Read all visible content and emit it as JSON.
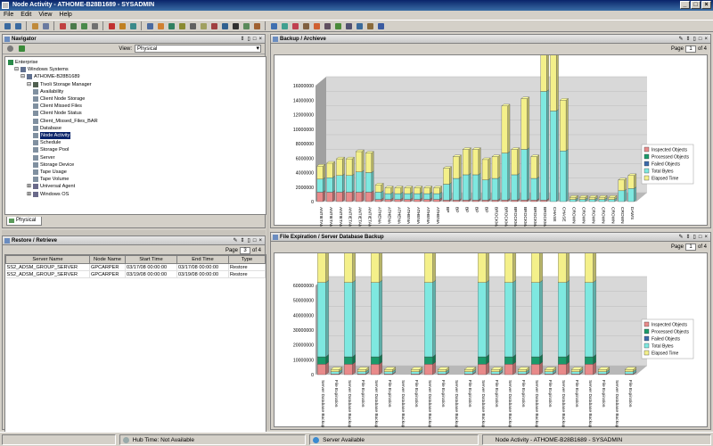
{
  "window": {
    "title": "Node Activity - ATHOME-B28B1689 - SYSADMIN"
  },
  "menu": [
    "File",
    "Edit",
    "View",
    "Help"
  ],
  "navigator": {
    "title": "Navigator",
    "view_label": "View:",
    "view_value": "Physical",
    "tab_label": "Physical",
    "tree": [
      {
        "label": "Enterprise",
        "level": 0,
        "icon": "globe-icon"
      },
      {
        "label": "Windows Systems",
        "level": 1,
        "icon": "computer-icon"
      },
      {
        "label": "ATHOME-B28B1689",
        "level": 2,
        "icon": "computer-icon"
      },
      {
        "label": "Tivoli Storage Manager",
        "level": 3,
        "icon": "storage-icon"
      },
      {
        "label": "Availability",
        "level": 4,
        "icon": "workspace-icon"
      },
      {
        "label": "Client Node Storage",
        "level": 4,
        "icon": "workspace-icon"
      },
      {
        "label": "Client Missed Files",
        "level": 4,
        "icon": "workspace-icon"
      },
      {
        "label": "Client Node Status",
        "level": 4,
        "icon": "workspace-icon"
      },
      {
        "label": "Client_Missed_Files_BAR",
        "level": 4,
        "icon": "workspace-icon"
      },
      {
        "label": "Database",
        "level": 4,
        "icon": "workspace-icon"
      },
      {
        "label": "Node Activity",
        "level": 4,
        "icon": "workspace-icon",
        "selected": true
      },
      {
        "label": "Schedule",
        "level": 4,
        "icon": "workspace-icon"
      },
      {
        "label": "Storage Pool",
        "level": 4,
        "icon": "workspace-icon"
      },
      {
        "label": "Server",
        "level": 4,
        "icon": "workspace-icon"
      },
      {
        "label": "Storage Device",
        "level": 4,
        "icon": "workspace-icon"
      },
      {
        "label": "Tape Usage",
        "level": 4,
        "icon": "workspace-icon"
      },
      {
        "label": "Tape Volume",
        "level": 4,
        "icon": "workspace-icon"
      },
      {
        "label": "Universal Agent",
        "level": 3,
        "icon": "agent-icon"
      },
      {
        "label": "Windows OS",
        "level": 3,
        "icon": "agent-icon"
      }
    ]
  },
  "restore": {
    "title": "Restore / Retrieve",
    "page_label": "Page",
    "page": "3",
    "page_total": "of 4",
    "columns": [
      "Server Name",
      "Node Name",
      "Start Time",
      "End Time",
      "Type"
    ],
    "rows": [
      [
        "SS2_ADSM_GROUP_SERVER",
        "GPCARPER",
        "03/17/08 00:00:00",
        "03/17/08 00:00:00",
        "Restore"
      ],
      [
        "SS2_ADSM_GROUP_SERVER",
        "GPCARPER",
        "03/19/08 00:00:00",
        "03/19/08 00:00:00",
        "Restore"
      ]
    ]
  },
  "backup": {
    "title": "Backup / Archieve",
    "page_label": "Page",
    "page": "1",
    "page_total": "of 4"
  },
  "expiration": {
    "title": "File Expiration / Server Database Backup",
    "page_label": "Page",
    "page": "1",
    "page_total": "of 4"
  },
  "legend_colors": {
    "Inspected Objects": "#e88a8a",
    "Processed Objects": "#1a9a6a",
    "Failed Objects": "#3a6aaa",
    "Total Bytes": "#7ee8e0",
    "Elapsed Time": "#f4f08a"
  },
  "chart_data": [
    {
      "type": "bar",
      "title": "Backup / Archieve",
      "ylim": [
        0,
        16000000
      ],
      "yticks": [
        "0",
        "2000000",
        "4000000",
        "6000000",
        "8000000",
        "10000000",
        "12000000",
        "14000000",
        "16000000"
      ],
      "legend": [
        "Inspected Objects",
        "Processed Objects",
        "Failed Objects",
        "Total Bytes",
        "Elapsed Time"
      ],
      "categories": [
        "ANTIETAM",
        "ANTIETAM",
        "ANTIETAM",
        "ANTIETAM",
        "ANTIETAM",
        "ANTIETAM",
        "ATHENA",
        "ATHENA",
        "ATHENA",
        "ATHENA",
        "ATHENA",
        "ATHENA",
        "ATHENA",
        "BP",
        "BP",
        "BP",
        "BP",
        "BP",
        "BROCKMAN",
        "BROCKMAN",
        "BROCKMAN",
        "BROCKMAN",
        "BROCKMAN",
        "BROCKMAN",
        "CHASE",
        "CHASE",
        "CROWN",
        "CROWN",
        "CROWN",
        "CROWN",
        "CROWN",
        "CROWN",
        "DAWS"
      ],
      "series": [
        {
          "name": "Inspected Objects",
          "values": [
            1300000,
            1300000,
            1300000,
            1300000,
            1300000,
            1300000,
            300000,
            300000,
            300000,
            300000,
            300000,
            300000,
            300000,
            200000,
            200000,
            200000,
            200000,
            200000,
            200000,
            200000,
            200000,
            200000,
            200000,
            200000,
            0,
            0,
            0,
            0,
            0,
            0,
            0,
            0,
            0
          ]
        },
        {
          "name": "Total Bytes",
          "values": [
            1800000,
            2000000,
            2300000,
            2300000,
            2800000,
            2700000,
            1000000,
            800000,
            800000,
            800000,
            800000,
            800000,
            800000,
            2200000,
            3000000,
            3500000,
            3500000,
            2800000,
            3000000,
            6500000,
            3500000,
            7000000,
            3000000,
            15000000,
            12500000,
            7000000,
            300000,
            300000,
            300000,
            300000,
            300000,
            1500000,
            1800000
          ]
        },
        {
          "name": "Elapsed Time",
          "values": [
            1800000,
            2000000,
            2300000,
            2300000,
            2800000,
            2700000,
            1000000,
            800000,
            800000,
            800000,
            800000,
            800000,
            800000,
            2200000,
            3000000,
            3500000,
            3500000,
            2800000,
            3000000,
            6500000,
            3500000,
            7000000,
            3000000,
            15000000,
            12500000,
            7000000,
            300000,
            300000,
            300000,
            300000,
            300000,
            1500000,
            1800000
          ]
        }
      ]
    },
    {
      "type": "bar",
      "title": "File Expiration / Server Database Backup",
      "ylim": [
        0,
        60000000
      ],
      "yticks": [
        "0",
        "10000000",
        "20000000",
        "30000000",
        "40000000",
        "50000000",
        "60000000"
      ],
      "legend": [
        "Inspected Objects",
        "Processed Objects",
        "Failed Objects",
        "Total Bytes",
        "Elapsed Time"
      ],
      "categories": [
        "Server Database Backup",
        "File Expiration",
        "Server Database Backup",
        "File Expiration",
        "Server Database Backup",
        "File Expiration",
        "Server Database Backup",
        "File Expiration",
        "Server Database Backup",
        "File Expiration",
        "Server Database Backup",
        "File Expiration",
        "Server Database Backup",
        "File Expiration",
        "Server Database Backup",
        "File Expiration",
        "Server Database Backup",
        "File Expiration",
        "Server Database Backup",
        "File Expiration",
        "Server Database Backup",
        "File Expiration",
        "Server Database Backup",
        "File Expiration"
      ],
      "series": [
        {
          "name": "Inspected Objects",
          "values": [
            7000000,
            500000,
            7000000,
            500000,
            7000000,
            500000,
            0,
            500000,
            7000000,
            500000,
            0,
            500000,
            7000000,
            500000,
            7000000,
            500000,
            7000000,
            500000,
            7000000,
            500000,
            7000000,
            500000,
            0,
            500000
          ]
        },
        {
          "name": "Processed Objects",
          "values": [
            5000000,
            0,
            5000000,
            0,
            5000000,
            0,
            0,
            0,
            5000000,
            0,
            0,
            0,
            5000000,
            0,
            5000000,
            0,
            5000000,
            0,
            5000000,
            0,
            5000000,
            0,
            0,
            0
          ]
        },
        {
          "name": "Total Bytes",
          "values": [
            50000000,
            1500000,
            50000000,
            1500000,
            50000000,
            1500000,
            0,
            1500000,
            50000000,
            1500000,
            0,
            1500000,
            50000000,
            1500000,
            50000000,
            1500000,
            50000000,
            1500000,
            50000000,
            1500000,
            50000000,
            1500000,
            0,
            1500000
          ]
        },
        {
          "name": "Elapsed Time",
          "values": [
            50000000,
            1500000,
            50000000,
            1500000,
            50000000,
            1500000,
            0,
            1500000,
            50000000,
            1500000,
            0,
            1500000,
            50000000,
            1500000,
            50000000,
            1500000,
            50000000,
            1500000,
            50000000,
            1500000,
            50000000,
            1500000,
            0,
            1500000
          ]
        }
      ]
    }
  ],
  "status": {
    "hub": "Hub Time: Not Available",
    "server": "Server Available",
    "workspace": "Node Activity - ATHOME-B28B1689 - SYSADMIN"
  }
}
